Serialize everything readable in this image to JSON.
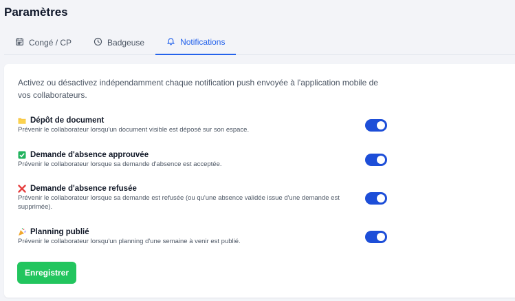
{
  "page": {
    "title": "Paramètres"
  },
  "tabs": [
    {
      "label": "Congé / CP",
      "icon": "calendar-icon",
      "active": false
    },
    {
      "label": "Badgeuse",
      "icon": "clock-icon",
      "active": false
    },
    {
      "label": "Notifications",
      "icon": "bell-icon",
      "active": true
    }
  ],
  "intro": "Activez ou désactivez indépendamment chaque notification push envoyée à l'application mobile de vos collaborateurs.",
  "notifications": [
    {
      "title": "Dépôt de document",
      "icon": "folder-icon",
      "description": "Prévenir le collaborateur lorsqu'un document visible est déposé sur son espace.",
      "enabled": true
    },
    {
      "title": "Demande d'absence approuvée",
      "icon": "check-box-icon",
      "description": "Prévenir le collaborateur lorsque sa demande d'absence est acceptée.",
      "enabled": true
    },
    {
      "title": "Demande d'absence refusée",
      "icon": "cross-mark-icon",
      "description": "Prévenir le collaborateur lorsque sa demande est refusée (ou qu'une absence validée issue d'une demande est supprimée).",
      "enabled": true
    },
    {
      "title": "Planning publié",
      "icon": "party-popper-icon",
      "description": "Prévenir le collaborateur lorsqu'un planning d'une semaine à venir est publié.",
      "enabled": true
    }
  ],
  "actions": {
    "save_label": "Enregistrer"
  },
  "colors": {
    "accent": "#2563eb",
    "toggle_on": "#1d4ed8",
    "save": "#22c55e"
  }
}
